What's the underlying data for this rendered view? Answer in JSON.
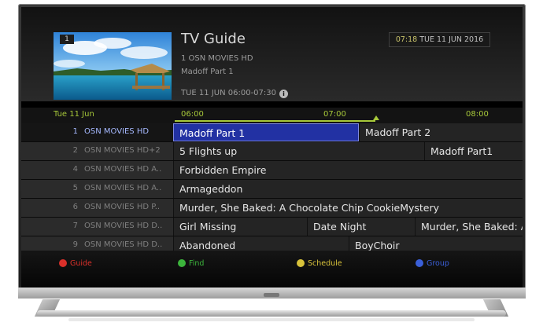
{
  "header": {
    "title": "TV Guide",
    "channel_line": "1   OSN MOVIES HD",
    "program_title": "Madoff Part 1",
    "schedule_line": "TUE 11 JUN   06:00-07:30",
    "clock_time": "07:18",
    "clock_date": "TUE 11 JUN 2016",
    "preview_channel_number": "1"
  },
  "timeline": {
    "date": "Tue 11 Jun",
    "times": [
      "06:00",
      "07:00",
      "08:00"
    ]
  },
  "channels": [
    {
      "number": "1",
      "name": "OSN MOVIES HD",
      "programs": [
        "Madoff Part 1",
        "Madoff Part 2"
      ]
    },
    {
      "number": "2",
      "name": "OSN MOVIES HD+2",
      "programs": [
        "5 Flights up",
        "Madoff Part1"
      ]
    },
    {
      "number": "4",
      "name": "OSN MOVIES HD A..",
      "programs": [
        "Forbidden Empire"
      ]
    },
    {
      "number": "5",
      "name": "OSN MOVIES HD A..",
      "programs": [
        "Armageddon"
      ]
    },
    {
      "number": "6",
      "name": "OSN MOVIES HD P..",
      "programs": [
        "Murder, She Baked: A Chocolate Chip CookieMystery"
      ]
    },
    {
      "number": "7",
      "name": "OSN MOVIES HD D..",
      "programs": [
        "Girl Missing",
        "Date Night",
        "Murder, She Baked: A"
      ]
    },
    {
      "number": "9",
      "name": "OSN MOVIES HD D..",
      "programs": [
        "Abandoned",
        "BoyChoir"
      ]
    }
  ],
  "footer": {
    "guide": "Guide",
    "find": "Find",
    "schedule": "Schedule",
    "group": "Group"
  },
  "colors": {
    "accent_green": "#a7c83a",
    "focus_blue": "#2231a3",
    "red_key": "#d9302a",
    "green_key": "#3cb43c",
    "yellow_key": "#d8c23a",
    "blue_key": "#3a5fd8"
  },
  "icons": [
    "info-icon",
    "red-key-icon",
    "green-key-icon",
    "yellow-key-icon",
    "blue-key-icon",
    "timeline-marker-icon"
  ]
}
